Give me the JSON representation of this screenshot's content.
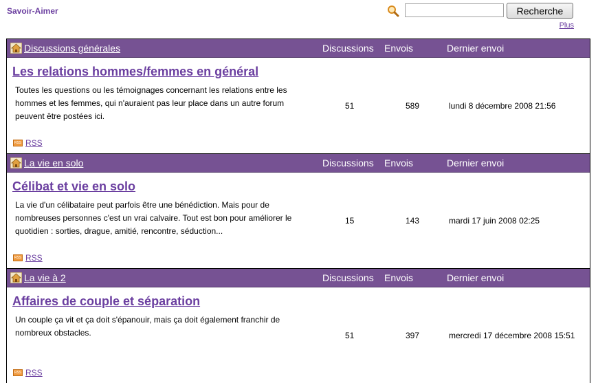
{
  "site": {
    "title": "Savoir-Aimer"
  },
  "search": {
    "placeholder": "",
    "value": "",
    "button_label": "Recherche",
    "more_label": "Plus"
  },
  "columns": {
    "discussions": "Discussions",
    "envois": "Envois",
    "dernier": "Dernier envoi"
  },
  "sections": [
    {
      "category": "Discussions générales",
      "forum_title": "Les relations hommes/femmes en général",
      "description": "Toutes les questions ou les témoignages concernant les relations entre les hommes et les femmes, qui n'auraient pas leur place dans un autre forum peuvent être postées ici.",
      "discussions": "51",
      "envois": "589",
      "last_post": "lundi 8 décembre 2008 21:56",
      "rss": "RSS"
    },
    {
      "category": "La vie en solo",
      "forum_title": "Célibat et vie en solo",
      "description": "La vie d'un célibataire peut parfois être une bénédiction. Mais pour de nombreuses personnes c'est un vrai calvaire. Tout est bon pour améliorer le quotidien : sorties, drague, amitié, rencontre, séduction...",
      "discussions": "15",
      "envois": "143",
      "last_post": "mardi 17 juin 2008 02:25",
      "rss": "RSS"
    },
    {
      "category": "La vie à 2",
      "forum_title": "Affaires de couple et séparation",
      "description": "Un couple ça vit et ça doit s'épanouir, mais ça doit également franchir de nombreux obstacles.",
      "discussions": "51",
      "envois": "397",
      "last_post": "mercredi 17 décembre 2008 15:51",
      "rss": "RSS"
    }
  ],
  "colors": {
    "header_bg": "#765293",
    "link": "#6b3fa0"
  },
  "icons": {
    "home": "home-icon",
    "search": "magnifier-icon",
    "rss": "rss-icon"
  }
}
